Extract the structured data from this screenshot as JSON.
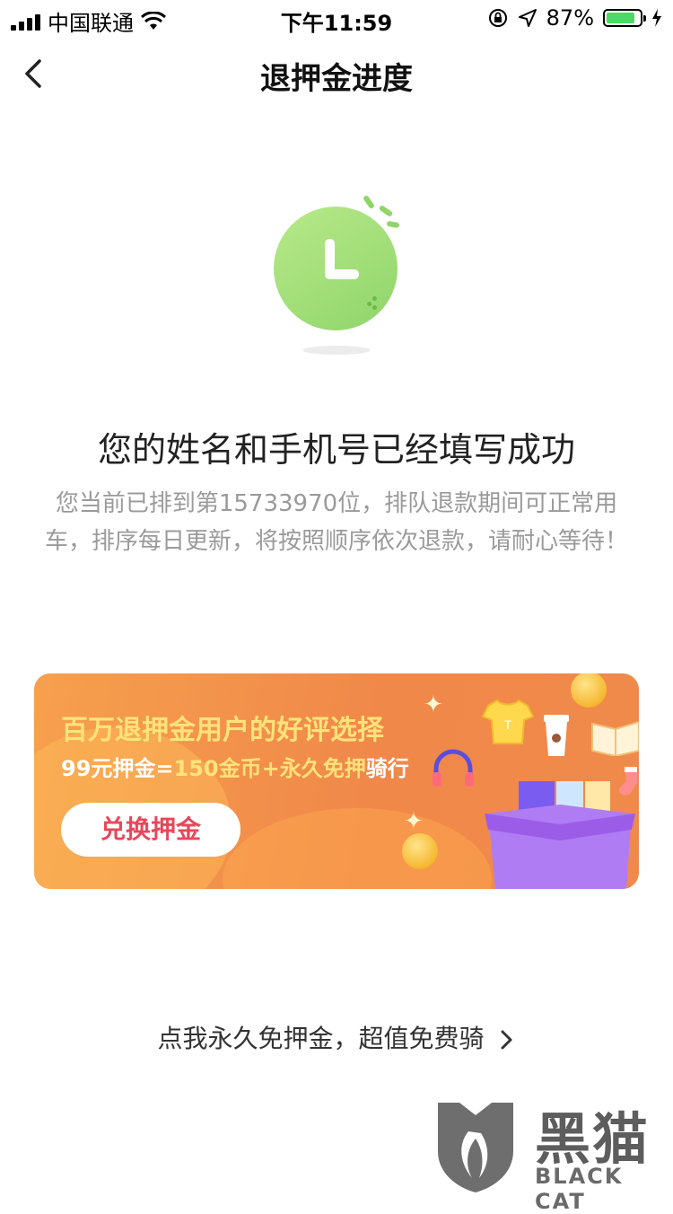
{
  "status_bar": {
    "carrier": "中国联通",
    "time": "下午11:59",
    "battery_percent": "87%",
    "battery_level": 0.87
  },
  "nav": {
    "title": "退押金进度"
  },
  "main": {
    "headline": "您的姓名和手机号已经填写成功",
    "description": "您当前已排到第15733970位，排队退款期间可正常用车，排序每日更新，将按照顺序依次退款，请耐心等待！"
  },
  "banner": {
    "title": "百万退押金用户的好评选择",
    "sub_part1": "99元押金=",
    "sub_part2": "150金币+永久免押",
    "sub_part3": "骑行",
    "button_label": "兑换押金"
  },
  "bottom_link": {
    "label": "点我永久免押金，超值免费骑"
  },
  "watermark": {
    "cn": "黑猫",
    "en": "BLACK CAT"
  },
  "colors": {
    "accent_green": "#8fd56a",
    "banner_orange": "#f0884a",
    "banner_yellow_text": "#ffe27a",
    "button_text_red": "#e8475a"
  }
}
